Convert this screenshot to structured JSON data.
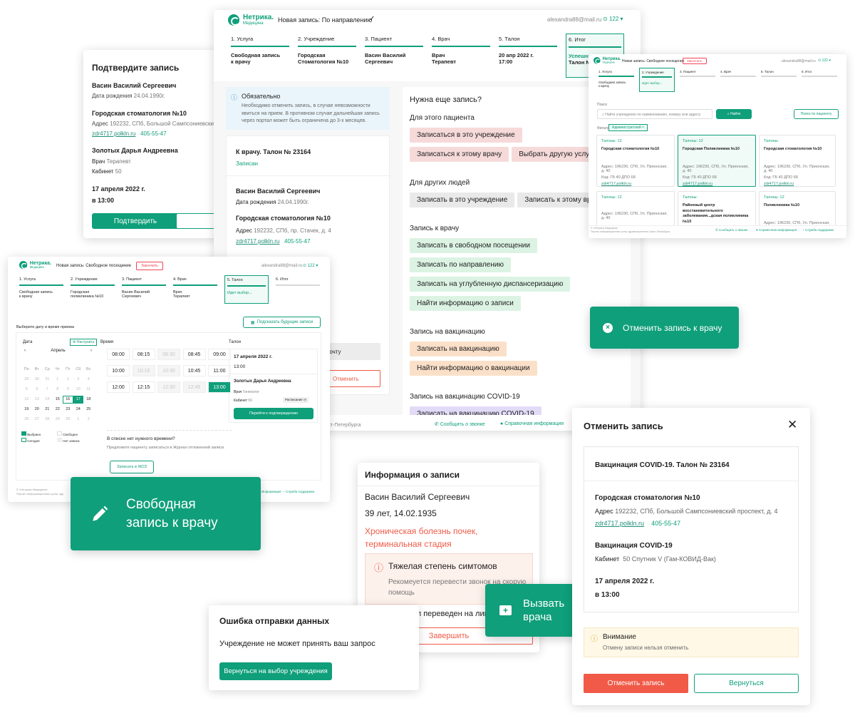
{
  "colors": {
    "accent": "#0f9f7a",
    "danger": "#f05a47",
    "warn_bg": "#fff8e6"
  },
  "icons": [
    "edit-pencil-icon",
    "first-aid-kit-icon",
    "close-circle-icon",
    "info-icon",
    "warning-icon",
    "phone-icon",
    "help-icon",
    "close-icon",
    "check-icon",
    "search-icon",
    "calendar-icon"
  ],
  "logo": {
    "name": "Нетрика.",
    "sub": "Медицина"
  },
  "confirm": {
    "title": "Подтвердите запись",
    "patient": "Васин Василий Сергеевич",
    "dob_label": "Дата рождения",
    "dob": "24.04.1990г.",
    "org": "Городская стоматология №10",
    "addr_label": "Адрес",
    "addr": "192232, СПб, Большой Сампсониевский прос",
    "site": "zdr4717.polkln.ru",
    "phone": "405-55-47",
    "doctor": "Золотых Дарья Андреевна",
    "role_label": "Врач",
    "role": "Терапевт",
    "room_label": "Кабинет",
    "room": "50",
    "date": "17 апреля 2022 г.",
    "time": "в 13:00",
    "btn_confirm": "Подтвердить",
    "btn_close": "Закр"
  },
  "main": {
    "header": "Новая запись: По направлению",
    "user": "alexandra88@mail.ru",
    "counter": "122",
    "steps": [
      {
        "n": "1. Услуга",
        "v1": "Свободная запись",
        "v2": "к врачу"
      },
      {
        "n": "2. Учреждение",
        "v1": "Городская",
        "v2": "Стоматология №10"
      },
      {
        "n": "3. Пациент",
        "v1": "Васин Василий",
        "v2": "Сергеевич"
      },
      {
        "n": "4. Врач",
        "v1": "Врач",
        "v2": "Терапевт"
      },
      {
        "n": "5. Талон",
        "v1": "20 апр 2022 г.",
        "v2": "17:00"
      },
      {
        "n": "6. Итог",
        "v1": "Успешн",
        "v2": "Талон N"
      }
    ],
    "notice_title": "Обязательно",
    "notice_text": "Необходимо отменить запись, в случае невозможности явиться на прием. В противном случае дальнейшая запись через портал может быть ограничена до 3-х месяцев.",
    "ticket": "К врачу. Талон № 23164",
    "status": "Записан",
    "patient": "Васин Василий Сергеевич",
    "dob_label": "Дата рождения",
    "dob": "24.04.1990г.",
    "org": "Городская стоматология №10",
    "addr_label": "Адрес",
    "addr": "192232, СПб, пр. Стачек, д. 4",
    "site": "zdr4717.polkln.ru",
    "phone": "405-55-47",
    "btn_mail": "почту",
    "btn_cancel": "Отменить",
    "need_title": "Нужна еще запись?",
    "sec_this": "Для этого пациента",
    "this": [
      "Записаться в это учреждение",
      "Записаться к этому врачу",
      "Выбрать другую услугу"
    ],
    "sec_other": "Для других людей",
    "other": [
      "Записать в это учреждение",
      "Записать к этому врачу"
    ],
    "sec_doc": "Запись к врачу",
    "doc": [
      "Записать в свободном посещении",
      "Записать по направлению",
      "Записать на углубленную диспансеризацию",
      "Найти информацию о записи"
    ],
    "sec_vac": "Запись на вакцинацию",
    "vac": [
      "Записать на вакцинацию",
      "Найти информацию о вакцинации"
    ],
    "sec_covid": "Запись на вакцинацию COVID-19",
    "covid": [
      "Записать на вакцинацию COVID-19"
    ],
    "footer_city": "анкт-Петербурга",
    "footer_call": "Сообщить о звонке",
    "footer_info": "Справочная информация"
  },
  "search": {
    "header": "Новая запись: Свободное посещение",
    "cancel": "Закончить",
    "user": "alexandra88@mail.ru",
    "counter": "122",
    "steps": [
      {
        "n": "1. Услуга",
        "v1": "Свободная запись",
        "v2": "к врачу"
      },
      {
        "n": "2. Учреждение",
        "v1": "Идет выбор...",
        "v2": ""
      },
      {
        "n": "3. Пациент",
        "v1": "",
        "v2": ""
      },
      {
        "n": "4. Врач",
        "v1": "",
        "v2": ""
      },
      {
        "n": "5. Талон",
        "v1": "",
        "v2": ""
      },
      {
        "n": "6. Итог",
        "v1": "",
        "v2": ""
      }
    ],
    "label": "Поиск",
    "placeholder": "Найти учреждение по наименованию, номеру или адресу",
    "btn_find": "Найти",
    "btn_patient": "Поиск по пациенту",
    "filter_label": "Фильтр",
    "filter": "Администратский",
    "tiles": [
      {
        "t": "Талоны: 12",
        "n": "Городская стоматология №10",
        "a": "Адрес: 196230, СПб, Ул. Прионская, д. 40",
        "c": "Код: ГБ 40 ДПО 68",
        "s": "zdr4717.polkln.ru"
      },
      {
        "t": "Талоны: 12",
        "n": "Городская Поликлиника №10",
        "a": "Адрес: 196230, СПб, Ул. Прионская, д. 40",
        "c": "Код: ГБ 40 ДПО 68",
        "s": "zdr4717.polkln.ru"
      },
      {
        "t": "Талоны:",
        "n": "Городская стоматология №10",
        "a": "Адрес: 196230, СПб, Ул. Прионская, д. 40",
        "c": "Код: ГБ 40 ДПО 68",
        "s": "zdr4717.polkln.ru"
      },
      {
        "t": "Талоны: 12",
        "n": "",
        "a": "Адрес: 196230, СПб, Ул. Прионская, д. 40",
        "c": "",
        "s": ""
      },
      {
        "t": "Талоны:",
        "n": "Районный центр восстановительного заболевания...дская поликлиника №10",
        "a": "Адрес: 196230, СПб, Ул. Прионская, д. 40",
        "c": "",
        "s": ""
      },
      {
        "t": "Талоны: 12",
        "n": "Поликлиника №10",
        "a": "Адрес: 196230, СПб, Ул. Прионская, д. 40",
        "c": "",
        "s": ""
      }
    ],
    "foot1": "© «Нетрика Медицина»",
    "foot2": "Портал информационных услуг здравоохранения Санкт-Петербурга",
    "foot_call": "Сообщить о звонке",
    "foot_info": "Справочная информация",
    "foot_help": "Служба поддержки"
  },
  "sched": {
    "header": "Новая запись: Свободное посещение",
    "cancel": "Закончить",
    "user": "alexandra88@mail.ru",
    "counter": "122",
    "steps": [
      {
        "n": "1. Услуга",
        "v1": "Свободная запись",
        "v2": "к врачу"
      },
      {
        "n": "2. Учреждение",
        "v1": "Городская",
        "v2": "поликлиника №10"
      },
      {
        "n": "3. Пациент",
        "v1": "Васин Василий",
        "v2": "Сергеевич"
      },
      {
        "n": "4. Врач",
        "v1": "Врач",
        "v2": "Терапевт"
      },
      {
        "n": "5. Талон",
        "v1": "Идет выбор...",
        "v2": ""
      },
      {
        "n": "6. Итог",
        "v1": "",
        "v2": ""
      }
    ],
    "btn_future": "Подсказать будущие записи",
    "choose": "Выберите дату и время приема",
    "col_date": "Дата",
    "btn_setup": "Настроить",
    "col_time": "Время",
    "col_ticket": "Талон",
    "month": "Апрель",
    "weekdays": [
      "Пн",
      "Вт",
      "Ср",
      "Чт",
      "Пт",
      "Сб",
      "Вс"
    ],
    "cal": [
      [
        "29",
        "30",
        "31",
        "1",
        "2",
        "3",
        "4"
      ],
      [
        "5",
        "6",
        "7",
        "8",
        "9",
        "10",
        "11"
      ],
      [
        "12",
        "13",
        "14",
        "15",
        "16",
        "17",
        "18"
      ],
      [
        "19",
        "20",
        "21",
        "22",
        "23",
        "24",
        "25"
      ],
      [
        "26",
        "27",
        "28",
        "29",
        "30",
        "1",
        "2"
      ]
    ],
    "times": [
      [
        "08:00",
        "08:15",
        "08:30",
        "08:45",
        "09:00"
      ],
      [
        "10:00",
        "10:15",
        "10:30",
        "10:45",
        "11:00"
      ],
      [
        "12:00",
        "12:15",
        "12:30",
        "12:45",
        "13:00"
      ]
    ],
    "legend": [
      "Выбрано",
      "Свободно",
      "Сегодня",
      "Нет записи"
    ],
    "no_time": "В списке нет нужного времени?",
    "no_time_hint": "Предложите пациенту записаться в Журнал отложенной записи.",
    "btn_jozz": "Записать в ЖОЗ",
    "t_date": "17 апреля 2022 г.",
    "t_time": "13:00",
    "t_doc": "Золотых Дарья Андреевна",
    "t_role_label": "Врач",
    "t_role": "Гинеколог",
    "t_room_label": "Кабинет",
    "t_room": "50",
    "t_sched": "Расписание",
    "btn_go": "Перейти к подтверждению",
    "foot1": "© «Нетрика Медицина»",
    "foot2": "Портал информационных услуг здр",
    "foot_info": "Информация",
    "foot_help": "Служба поддержки"
  },
  "badge_free": {
    "line1": "Свободная",
    "line2": "запись к врачу"
  },
  "badge_cancel": "Отменить запись к врачу",
  "badge_call": {
    "line1": "Вызвать",
    "line2": "врача"
  },
  "info": {
    "title": "Информация о записи",
    "name": "Васин Василий Сергеевич",
    "age": "39 лет, 14.02.1935",
    "diag1": "Хроническая болезнь почек,",
    "diag2": "терминальная стадия",
    "alert": "Тяжелая степень симтомов",
    "alert_text": "Рекомеуется перевести звонок на скорую помощь",
    "checkbox": "Звонок был переведен на лин",
    "btn_finish": "Завершить"
  },
  "error": {
    "title": "Ошибка отправки данных",
    "text": "Учреждение не может принять ваш запрос",
    "btn": "Вернуться на выбор учреждения"
  },
  "cancel": {
    "title": "Отменить запись",
    "ticket": "Вакцинация COVID-19. Талон № 23164",
    "org": "Городская стоматология №10",
    "addr_label": "Адрес",
    "addr": "192232, СПб, Большой Сампсониевский проспект, д. 4",
    "site": "zdr4717.polkln.ru",
    "phone": "405-55-47",
    "service": "Вакцинация COVID-19",
    "room_label": "Кабинет",
    "room": "50 Спутник V (Гам-КОВИД-Вак)",
    "date": "17 апреля 2022 г.",
    "time": "в 13:00",
    "warn_title": "Внимание",
    "warn_text": "Отмену записи нельзя отменить",
    "btn_cancel": "Отменить запись",
    "btn_back": "Вернуться"
  }
}
